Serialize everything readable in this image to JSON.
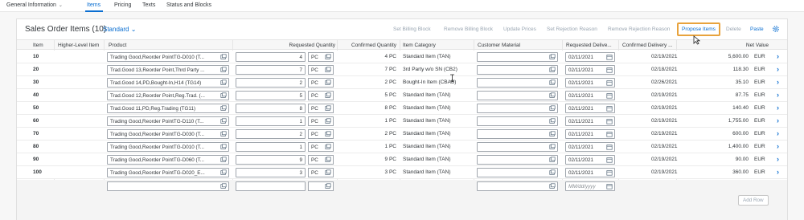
{
  "tabs": [
    {
      "label": "General Information",
      "caret": "⌄"
    },
    {
      "label": "Items",
      "active": true
    },
    {
      "label": "Pricing"
    },
    {
      "label": "Texts"
    },
    {
      "label": "Status and Blocks"
    }
  ],
  "toolbar": {
    "title": "Sales Order Items (10)",
    "variant": "Standard",
    "variant_caret": "⌄",
    "set_billing_block": "Set Billing Block",
    "remove_billing_block": "Remove Billing Block",
    "update_prices": "Update Prices",
    "set_rejection_reason": "Set Rejection Reason",
    "remove_rejection_reason": "Remove Rejection Reason",
    "propose_items": "Propose Items",
    "delete": "Delete",
    "paste": "Paste",
    "settings_icon": "gear-icon"
  },
  "columns": {
    "item": "Item",
    "higher_level_item": "Higher-Level Item",
    "product": "Product",
    "requested_quantity": "Requested Quantity",
    "confirmed_quantity": "Confirmed Quantity",
    "item_category": "Item Category",
    "customer_material": "Customer Material",
    "requested_delivery": "Requested Delive...",
    "confirmed_delivery": "Confirmed Delivery ...",
    "net_value": "Net Value"
  },
  "rows": [
    {
      "item": "10",
      "product": "Trading Good,Reorder PointTG-D010 (T...",
      "qty": "4",
      "unit": "PC",
      "confirmed_qty": "4 PC",
      "category": "Standard Item (TAN)",
      "req_date": "02/11/2021",
      "conf_date": "02/19/2021",
      "net_value": "5,600.00",
      "currency": "EUR"
    },
    {
      "item": "20",
      "product": "Trad.Good 13,Reorder Point,Thrd Party ...",
      "qty": "7",
      "unit": "PC",
      "confirmed_qty": "7 PC",
      "category": "3rd Party w/o SN (CB2)",
      "req_date": "02/11/2021",
      "conf_date": "02/18/2021",
      "net_value": "118.30",
      "currency": "EUR"
    },
    {
      "item": "30",
      "product": "Trad.Good 14,PD,Bought-In,H14 (TG14)",
      "qty": "2",
      "unit": "PC",
      "confirmed_qty": "2 PC",
      "category": "Bought-In Item (CBAB)",
      "req_date": "02/11/2021",
      "conf_date": "02/26/2021",
      "net_value": "35.10",
      "currency": "EUR"
    },
    {
      "item": "40",
      "product": "Trad.Good 12,Reorder Point,Reg.Trad. (...",
      "qty": "5",
      "unit": "PC",
      "confirmed_qty": "5 PC",
      "category": "Standard Item (TAN)",
      "req_date": "02/11/2021",
      "conf_date": "02/19/2021",
      "net_value": "87.75",
      "currency": "EUR"
    },
    {
      "item": "50",
      "product": "Trad.Good 11,PD,Reg.Trading (TG11)",
      "qty": "8",
      "unit": "PC",
      "confirmed_qty": "8 PC",
      "category": "Standard Item (TAN)",
      "req_date": "02/11/2021",
      "conf_date": "02/19/2021",
      "net_value": "140.40",
      "currency": "EUR"
    },
    {
      "item": "60",
      "product": "Trading Good,Reorder PointTG-D110 (T...",
      "qty": "1",
      "unit": "PC",
      "confirmed_qty": "1 PC",
      "category": "Standard Item (TAN)",
      "req_date": "02/11/2021",
      "conf_date": "02/19/2021",
      "net_value": "1,755.00",
      "currency": "EUR"
    },
    {
      "item": "70",
      "product": "Trading Good,Reorder PointTG-D030 (T...",
      "qty": "2",
      "unit": "PC",
      "confirmed_qty": "2 PC",
      "category": "Standard Item (TAN)",
      "req_date": "02/11/2021",
      "conf_date": "02/19/2021",
      "net_value": "600.00",
      "currency": "EUR"
    },
    {
      "item": "80",
      "product": "Trading Good,Reorder PointTG-D010 (T...",
      "qty": "1",
      "unit": "PC",
      "confirmed_qty": "1 PC",
      "category": "Standard Item (TAN)",
      "req_date": "02/11/2021",
      "conf_date": "02/19/2021",
      "net_value": "1,400.00",
      "currency": "EUR"
    },
    {
      "item": "90",
      "product": "Trading Good,Reorder PointTG-D060 (T...",
      "qty": "9",
      "unit": "PC",
      "confirmed_qty": "9 PC",
      "category": "Standard Item (TAN)",
      "req_date": "02/11/2021",
      "conf_date": "02/19/2021",
      "net_value": "90.00",
      "currency": "EUR"
    },
    {
      "item": "100",
      "product": "Trading Good,Reorder PointTG-D020_E...",
      "qty": "3",
      "unit": "PC",
      "confirmed_qty": "3 PC",
      "category": "Standard Item (TAN)",
      "req_date": "02/11/2021",
      "conf_date": "02/19/2021",
      "net_value": "360.00",
      "currency": "EUR"
    }
  ],
  "new_row": {
    "date_placeholder": "MM/dd/yyyy"
  },
  "add_row": "Add Row"
}
